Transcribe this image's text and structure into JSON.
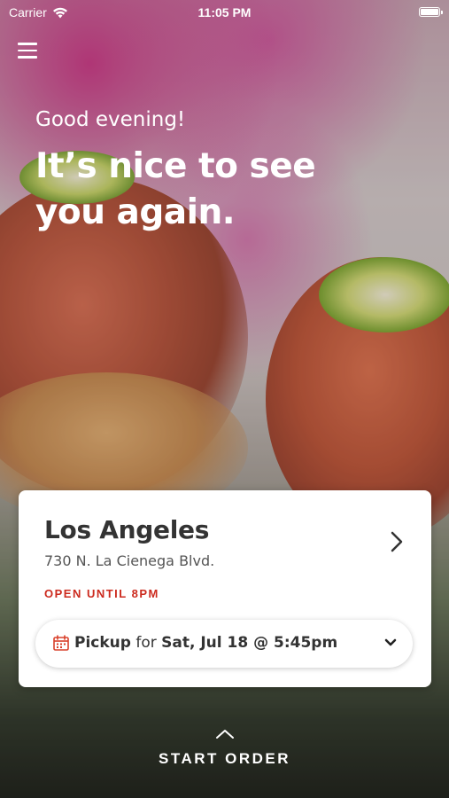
{
  "status_bar": {
    "carrier": "Carrier",
    "time": "11:05 PM"
  },
  "header": {
    "greeting": "Good evening!",
    "headline": "It’s nice to see you again."
  },
  "location_card": {
    "name": "Los Angeles",
    "address": "730 N. La Cienega Blvd.",
    "status": "OPEN UNTIL 8PM",
    "status_color": "#cc2a1e",
    "pickup": {
      "mode": "Pickup",
      "connector": " for ",
      "datetime": "Sat, Jul 18 @ 5:45pm"
    }
  },
  "footer": {
    "start_order_label": "START ORDER"
  },
  "icons": [
    "wifi-icon",
    "battery-icon",
    "menu-icon",
    "chevron-right-icon",
    "calendar-icon",
    "chevron-down-icon",
    "chevron-up-icon"
  ]
}
